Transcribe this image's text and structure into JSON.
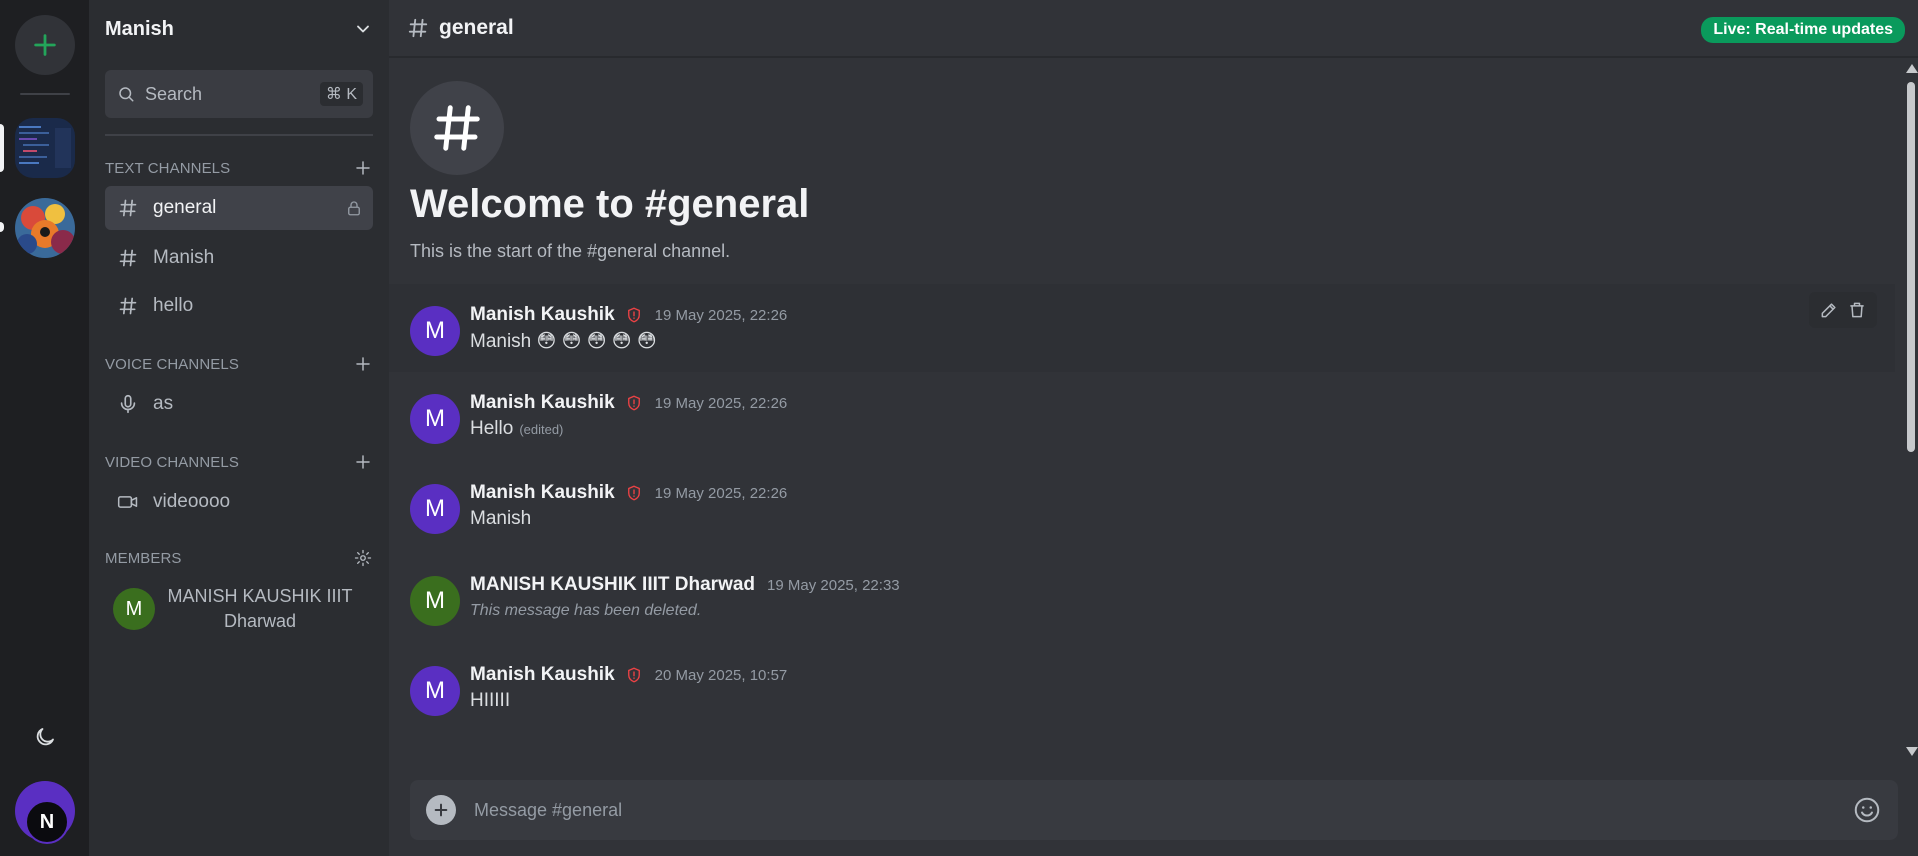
{
  "rail": {
    "add_label": "+"
  },
  "server": {
    "name": "Manish"
  },
  "search": {
    "label": "Search",
    "shortcut": "⌘ K"
  },
  "sections": {
    "text": "TEXT CHANNELS",
    "voice": "VOICE CHANNELS",
    "video": "VIDEO CHANNELS",
    "members": "MEMBERS"
  },
  "text_channels": [
    {
      "name": "general"
    },
    {
      "name": "Manish"
    },
    {
      "name": "hello"
    }
  ],
  "voice_channels": [
    {
      "name": "as"
    }
  ],
  "video_channels": [
    {
      "name": "videoooo"
    }
  ],
  "members": [
    {
      "initial": "M",
      "name": "MANISH KAUSHIK IIIT Dharwad"
    }
  ],
  "topbar": {
    "channel": "general",
    "live_badge": "Live: Real-time updates"
  },
  "welcome": {
    "title": "Welcome to #general",
    "subtitle": "This is the start of the #general channel."
  },
  "messages": [
    {
      "initial": "M",
      "author": "Manish Kaushik",
      "timestamp": "19 May 2025, 22:26",
      "text": "Manish 😳 😳 😳 😳 😳"
    },
    {
      "initial": "M",
      "author": "Manish Kaushik",
      "timestamp": "19 May 2025, 22:26",
      "text": "Hello",
      "edited": "(edited)"
    },
    {
      "initial": "M",
      "author": "Manish Kaushik",
      "timestamp": "19 May 2025, 22:26",
      "text": "Manish"
    },
    {
      "initial": "M",
      "author": "MANISH KAUSHIK IIIT Dharwad",
      "timestamp": "19 May 2025, 22:33",
      "text": "This message has been deleted."
    },
    {
      "initial": "M",
      "author": "Manish Kaushik",
      "timestamp": "20 May 2025, 10:57",
      "text": "HIIIII"
    }
  ],
  "composer": {
    "placeholder": "Message #general"
  },
  "user": {
    "badge": "N"
  },
  "colors": {
    "accent_green": "#0a9a5c",
    "avatar_purple": "#5a2fc2",
    "avatar_green": "#3a6e1e",
    "admin_shield": "#ed4245"
  }
}
